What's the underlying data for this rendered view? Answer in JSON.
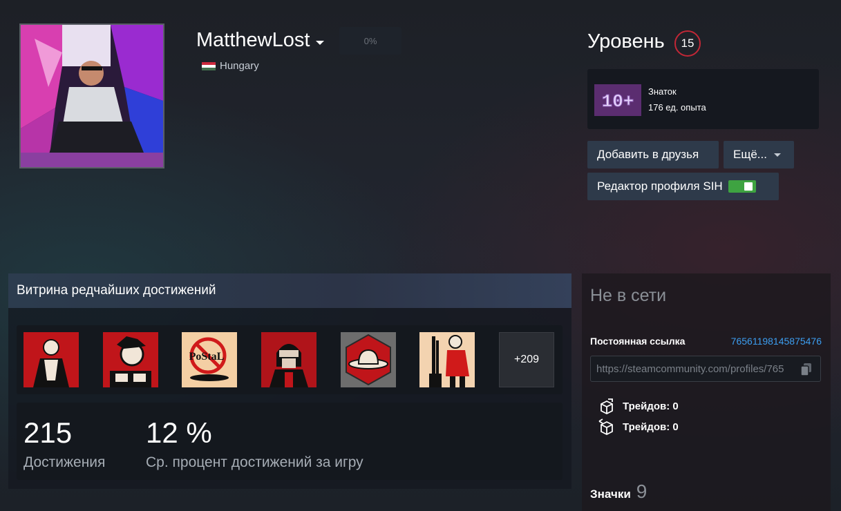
{
  "profile": {
    "persona_name": "MatthewLost",
    "progress_label": "0%",
    "country": "Hungary",
    "avatar_icon": "profile-avatar-photo"
  },
  "level": {
    "title": "Уровень",
    "value": "15",
    "badge_name": "Знаток",
    "badge_points": "176 ед. опыта",
    "badge_icon_text": "10+"
  },
  "actions": {
    "add_friend": "Добавить в друзья",
    "more": "Ещё...",
    "sih_editor": "Редактор профиля SIH",
    "sih_toggle_on": true
  },
  "showcase": {
    "title": "Витрина редчайших достижений",
    "achievements": [
      {
        "icon": "achievement-man-opening-shirt-icon",
        "bg": "#c0151a"
      },
      {
        "icon": "achievement-bearded-man-icon",
        "bg": "#c0151a"
      },
      {
        "icon": "achievement-no-postal-icon",
        "bg": "#f4cfa4"
      },
      {
        "icon": "achievement-helmet-soldier-icon",
        "bg": "#b0141a"
      },
      {
        "icon": "achievement-cowboy-hat-icon",
        "bg": "#c0151a"
      },
      {
        "icon": "achievement-woman-with-rifle-icon",
        "bg": "#f3d3b0"
      }
    ],
    "more_count": "+209",
    "stats": {
      "total_value": "215",
      "total_label": "Достижения",
      "avg_value": "12 %",
      "avg_label": "Ср. процент достижений за игру"
    }
  },
  "sidebar": {
    "status": "Не в сети",
    "permalink_label": "Постоянная ссылка",
    "permalink_id": "76561198145875476",
    "permalink_url": "https://steamcommunity.com/profiles/765",
    "trades": [
      {
        "label": "Трейдов: 0",
        "icon": "trade-box-icon"
      },
      {
        "label": "Трейдов: 0",
        "icon": "trade-box-arrows-icon"
      }
    ],
    "badges_label": "Значки",
    "badges_count": "9"
  },
  "colors": {
    "level_ring": "#c22736",
    "link": "#3c9ef0",
    "toggle_on": "#3ea341",
    "button_bg": "#2e3a4a"
  }
}
